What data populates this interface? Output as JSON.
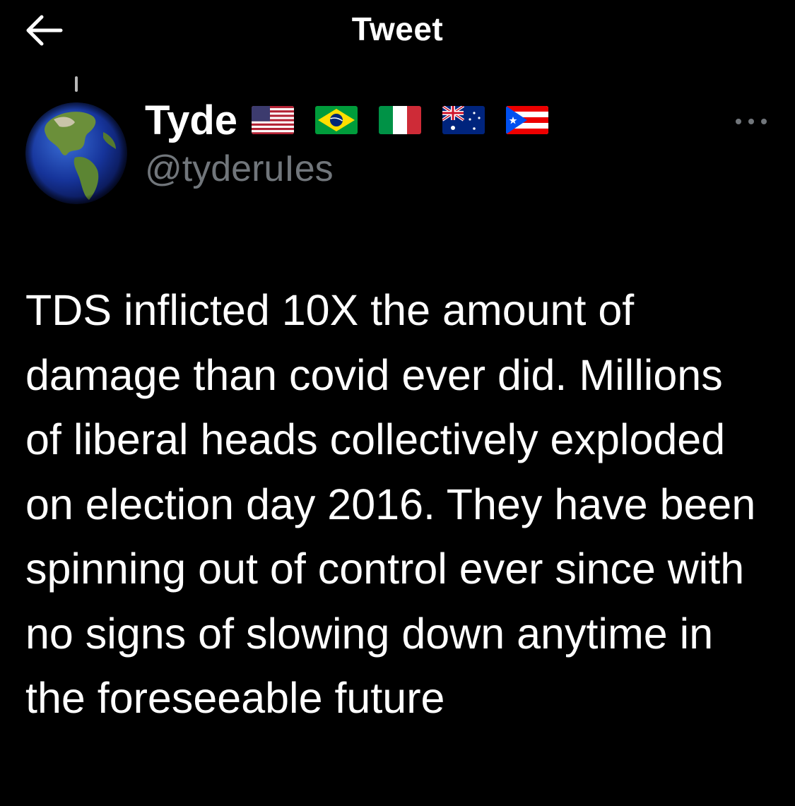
{
  "header": {
    "title": "Tweet",
    "back_icon": "arrow-left-icon"
  },
  "author": {
    "display_name": "Tyde",
    "handle": "@tyderuIes",
    "avatar_icon": "globe-avatar",
    "flags": [
      "us-flag-icon",
      "brazil-flag-icon",
      "italy-flag-icon",
      "australia-flag-icon",
      "puerto-rico-flag-icon"
    ]
  },
  "more_icon": "more-dots-icon",
  "tweet": {
    "text": "TDS inflicted 10X the amount of damage than covid ever did. Millions of liberal heads collectively exploded on election day 2016. They have been spinning out of control ever since with no signs of slowing down anytime in the foreseeable future"
  },
  "colors": {
    "background": "#000000",
    "text": "#ffffff",
    "secondary_text": "#71767b"
  }
}
